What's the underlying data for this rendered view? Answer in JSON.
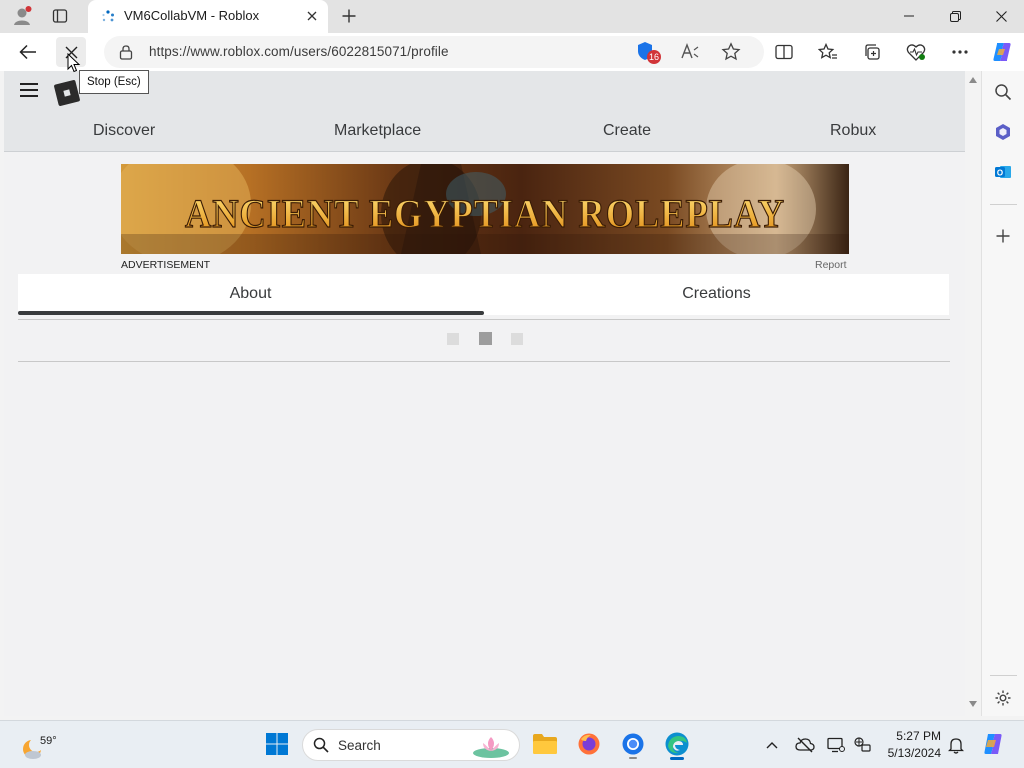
{
  "browser": {
    "tab": {
      "title": "VM6CollabVM - Roblox"
    },
    "address": {
      "url": "https://www.roblox.com/users/6022815071/profile"
    },
    "tooltip": "Stop (Esc)",
    "badge_count": "16",
    "accent_color": "#0067c0"
  },
  "site": {
    "nav": [
      "Discover",
      "Marketplace",
      "Create",
      "Robux"
    ],
    "ad": {
      "banner_text": "ANCIENT EGYPTIAN ROLEPLAY",
      "label": "ADVERTISEMENT",
      "report": "Report"
    },
    "profile_tabs": [
      {
        "label": "About",
        "selected": true
      },
      {
        "label": "Creations",
        "selected": false
      }
    ],
    "loader": "loading-indicator"
  },
  "taskbar": {
    "weather": "59°",
    "search_label": "Search",
    "time": "5:27 PM",
    "date": "5/13/2024"
  }
}
